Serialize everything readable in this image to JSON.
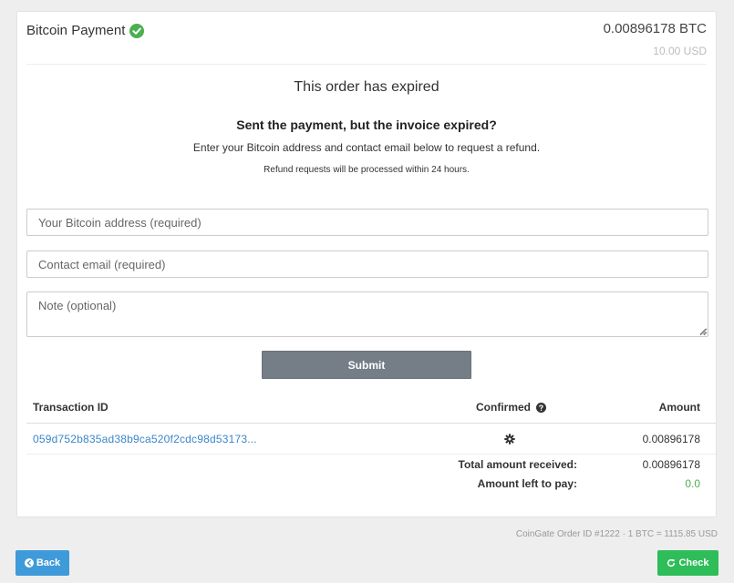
{
  "header": {
    "title": "Bitcoin Payment",
    "btc_amount": "0.00896178 BTC",
    "usd_amount": "10.00 USD"
  },
  "status": {
    "expired": "This order has expired",
    "sent_question": "Sent the payment, but the invoice expired?",
    "instructions": "Enter your Bitcoin address and contact email below to request a refund.",
    "processing_note": "Refund requests will be processed within 24 hours."
  },
  "form": {
    "address_placeholder": "Your Bitcoin address (required)",
    "email_placeholder": "Contact email (required)",
    "note_placeholder": "Note (optional)",
    "submit_label": "Submit"
  },
  "table": {
    "headers": {
      "tx_id": "Transaction ID",
      "confirmed": "Confirmed",
      "amount": "Amount"
    },
    "rows": [
      {
        "tx_id": "059d752b835ad38b9ca520f2cdc98d53173...",
        "amount": "0.00896178"
      }
    ],
    "total_label": "Total amount received:",
    "total_value": "0.00896178",
    "left_label": "Amount left to pay:",
    "left_value": "0.0"
  },
  "footer": {
    "order_info": "CoinGate Order ID #1222 · 1 BTC = 1115.85 USD",
    "back_label": "Back",
    "check_label": "Check"
  },
  "colors": {
    "accent_blue": "#3f9ad9",
    "accent_green": "#2ebd59",
    "submit_gray": "#757d87",
    "link_blue": "#3a86c8"
  },
  "icons": [
    "check-circle-icon",
    "question-circle-icon",
    "gear-icon",
    "arrow-left-icon",
    "refresh-icon"
  ]
}
